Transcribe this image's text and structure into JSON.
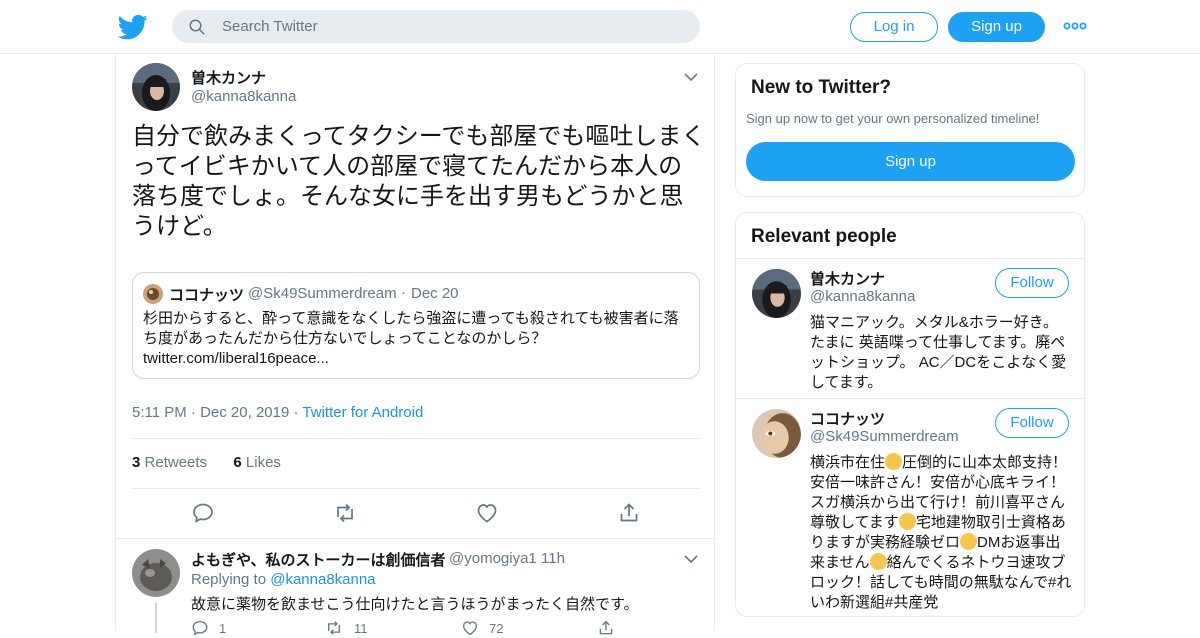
{
  "nav": {
    "search_placeholder": "Search Twitter",
    "login_label": "Log in",
    "signup_label": "Sign up",
    "brand_color": "#1da1f2"
  },
  "tweet": {
    "author_name": "曽木カンナ",
    "author_handle": "@kanna8kanna",
    "text": "自分で飲みまくってタクシーでも部屋でも嘔吐しまくってイビキかいて人の部屋で寝てたんだから本人の落ち度でしょ。そんな女に手を出す男もどうかと思うけど。",
    "quote": {
      "name": "ココナッツ",
      "handle": "@Sk49Summerdream",
      "date": "Dec 20",
      "text": "杉田からすると、酔って意識をなくしたら強盗に遭っても殺されても被害者に落ち度があったんだから仕方ないでしょってことなのかしら？",
      "link": "twitter.com/liberal16peace..."
    },
    "time": "5:11 PM",
    "date": "Dec 20, 2019",
    "source": "Twitter for Android",
    "retweets_count": "3",
    "retweets_label": "Retweets",
    "likes_count": "6",
    "likes_label": "Likes"
  },
  "reply": {
    "name": "よもぎや、私のストーカーは創価信者",
    "handle": "@yomogiya1",
    "time": "11h",
    "replying_prefix": "Replying to",
    "replying_to": "@kanna8kanna",
    "text": "故意に薬物を飲ませこう仕向けたと言うほうがまったく自然です。",
    "reply_count": "1",
    "retweet_count": "11",
    "like_count": "72"
  },
  "sidebar": {
    "new_title": "New to Twitter?",
    "new_sub": "Sign up now to get your own personalized timeline!",
    "new_button": "Sign up",
    "relevant_title": "Relevant people",
    "people": [
      {
        "name": "曽木カンナ",
        "handle": "@kanna8kanna",
        "follow": "Follow",
        "bio": "猫マニアック。メタル&ホラー好き。たまに 英語喋って仕事してます。廃ペットショップ。 AC／DCをこよなく愛してます。"
      },
      {
        "name": "ココナッツ",
        "handle": "@Sk49Summerdream",
        "follow": "Follow",
        "bio_1": "横浜市在住",
        "bio_2": "圧倒的に山本太郎支持！安倍一味許さん！安倍が心底キライ！スガ横浜から出て行け！前川喜平さん尊敬してます",
        "bio_3": "宅地建物取引士資格ありますが実務経験ゼロ",
        "bio_4": "DMお返事出来ません",
        "bio_5": "絡んでくるネトウヨ速攻ブロック！話しても時間の無駄なんで#れいわ新選組#共産党"
      }
    ]
  }
}
